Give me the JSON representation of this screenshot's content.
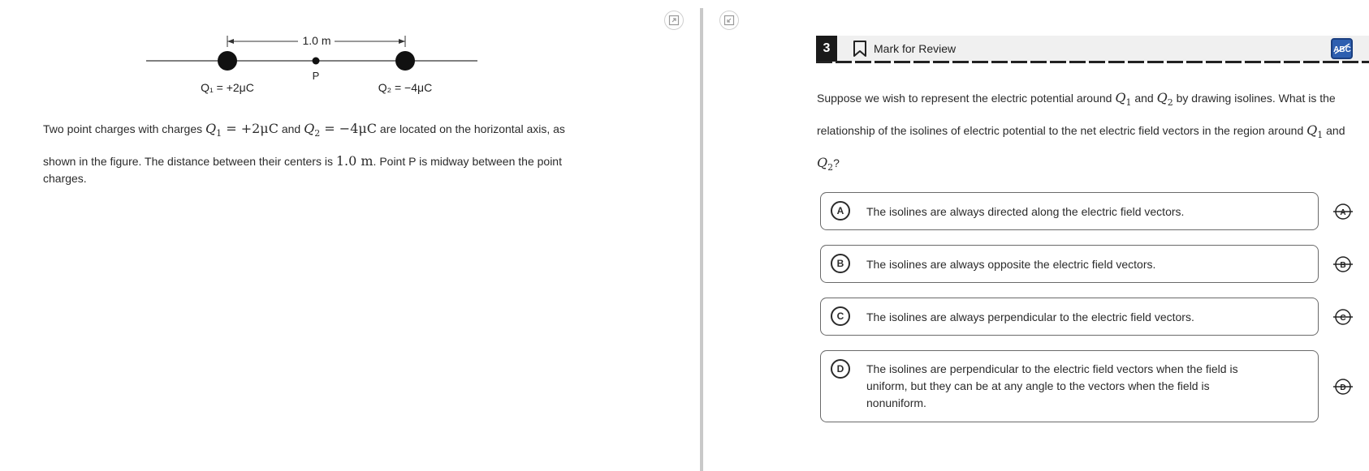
{
  "figure": {
    "distance_label": "1.0 m",
    "point_label": "P",
    "charge1_label": "Q₁ = +2μC",
    "charge2_label": "Q₂ = −4μC"
  },
  "stimulus": {
    "t1": "Two point charges with charges ",
    "q1_symbol": "Q",
    "q1_sub": "1",
    "q1_value": " = +2μC",
    "t2": " and ",
    "q2_symbol": "Q",
    "q2_sub": "2",
    "q2_value": " = −4μC",
    "t3": " are located on the horizontal axis, as shown in the figure. The distance between their centers is ",
    "distance": "1.0 m",
    "t4": ". Point P is midway between the point",
    "t5": "charges."
  },
  "toolbar": {
    "expand_icon": "expand-icon",
    "collapse_icon": "collapse-icon"
  },
  "question_header": {
    "number": "3",
    "mark_label": "Mark for Review",
    "abc_icon": "abc-crossout-icon"
  },
  "question": {
    "t1": "Suppose we wish to represent the electric potential around ",
    "q1_symbol": "Q",
    "q1_sub": "1",
    "t2": " and ",
    "q2_symbol": "Q",
    "q2_sub": "2",
    "t3": " by drawing isolines. What is the relationship of the isolines of electric potential to the net electric field vectors in the region around ",
    "q3_symbol": "Q",
    "q3_sub": "1",
    "t4": " and",
    "q4_symbol": "Q",
    "q4_sub": "2",
    "t5": "?"
  },
  "options": [
    {
      "letter": "A",
      "text": "The isolines are always directed along the electric field vectors."
    },
    {
      "letter": "B",
      "text": "The isolines are always opposite the electric field vectors."
    },
    {
      "letter": "C",
      "text": "The isolines are always perpendicular to the electric field vectors."
    },
    {
      "letter": "D",
      "line1": "The isolines are perpendicular to the electric field vectors when the field is",
      "line2": "uniform, but they can be at any angle to the vectors when the field is",
      "line3": "nonuniform."
    }
  ],
  "colors": {
    "accent": "#2e5fb0",
    "header_bg": "#f0f0f0",
    "divider": "#c9c9c9"
  }
}
